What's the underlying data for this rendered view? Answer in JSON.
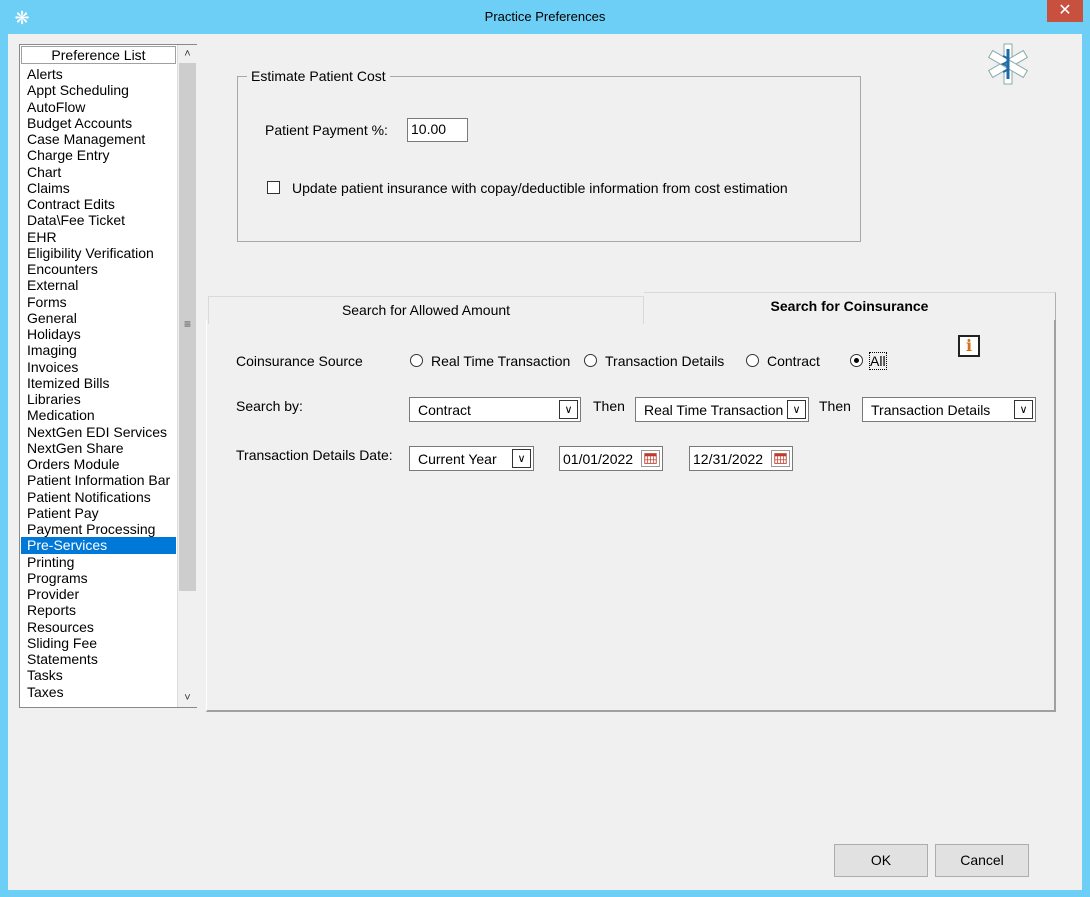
{
  "window": {
    "title": "Practice Preferences",
    "close_glyph": "✕"
  },
  "pref_list": {
    "header": "Preference List",
    "items": [
      "Alerts",
      "Appt Scheduling",
      "AutoFlow",
      "Budget Accounts",
      "Case Management",
      "Charge Entry",
      "Chart",
      "Claims",
      "Contract Edits",
      "Data\\Fee Ticket",
      "EHR",
      "Eligibility Verification",
      "Encounters",
      "External",
      "Forms",
      "General",
      "Holidays",
      "Imaging",
      "Invoices",
      "Itemized Bills",
      "Libraries",
      "Medication",
      "NextGen EDI Services",
      "NextGen Share",
      "Orders Module",
      "Patient Information Bar",
      "Patient Notifications",
      "Patient Pay",
      "Payment Processing",
      "Pre-Services",
      "Printing",
      "Programs",
      "Provider",
      "Reports",
      "Resources",
      "Sliding Fee",
      "Statements",
      "Tasks",
      "Taxes"
    ],
    "selected": "Pre-Services"
  },
  "estimate": {
    "legend": "Estimate Patient Cost",
    "payment_label": "Patient Payment %:",
    "payment_value": "10.00",
    "update_checkbox_label": "Update patient insurance with copay/deductible information from cost estimation",
    "update_checked": false
  },
  "tabs": {
    "allowed": "Search for Allowed Amount",
    "coinsurance": "Search for Coinsurance",
    "active": "coinsurance"
  },
  "coinsurance": {
    "source_label": "Coinsurance Source",
    "options": [
      "Real Time Transaction",
      "Transaction Details",
      "Contract",
      "All"
    ],
    "selected": "All",
    "search_by_label": "Search by:",
    "then_label": "Then",
    "search_by": [
      "Contract",
      "Real Time Transaction",
      "Transaction Details"
    ],
    "date_label": "Transaction Details Date:",
    "date_range": "Current Year",
    "start_date": "01/01/2022",
    "end_date": "12/31/2022"
  },
  "buttons": {
    "ok": "OK",
    "cancel": "Cancel"
  },
  "icons": {
    "info": "i",
    "app": "asterisk-icon",
    "logo": "star-of-life-icon"
  }
}
